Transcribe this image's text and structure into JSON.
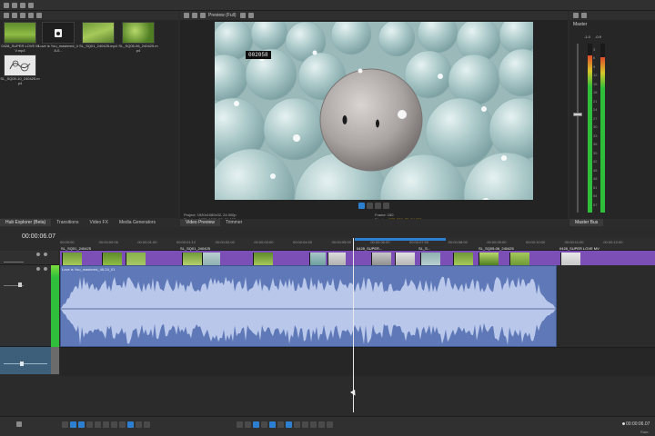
{
  "project_media": {
    "items": [
      {
        "label": "0428_SUPER LOVE MV.mp4",
        "thumb": "green-field"
      },
      {
        "label": "Love is You_mastered_48-0...",
        "thumb": "audio"
      },
      {
        "label": "SL_SQ01_240425.mp4",
        "thumb": "green-field"
      },
      {
        "label": "SL_SQ05-06_240425.mp4",
        "thumb": "green-leaves"
      },
      {
        "label": "SL_SQ09-10_240425.mp4",
        "thumb": "sketch"
      }
    ]
  },
  "left_tabs": [
    "Hub Explorer (Beta)",
    "Transitions",
    "Video FX",
    "Media Generators"
  ],
  "preview": {
    "toolbar_label": "Preview (Full)",
    "frame_badge": "002058",
    "info_project": "Project:",
    "info_project_val": "1920x1080x32, 24.000p",
    "info_preview": "Preview:",
    "info_preview_val": "1920x1080x32, 24.000p",
    "info_frame": "Frame:",
    "info_frame_val": "150",
    "info_display": "Display:",
    "info_display_val": "533x300x32, 24.000",
    "tabs": [
      "Video Preview",
      "Trimmer"
    ]
  },
  "master": {
    "title": "Master",
    "values": [
      "-1.0",
      "-0.9"
    ],
    "scale": [
      "3",
      "6",
      "9",
      "12",
      "15",
      "18",
      "21",
      "24",
      "27",
      "30",
      "33",
      "36",
      "39",
      "42",
      "45",
      "48",
      "51",
      "54",
      "57"
    ],
    "level_left": 0.93,
    "level_right": 0.92,
    "tab": "Master Bus"
  },
  "timeline": {
    "timecode": "00:00:06.07",
    "ruler": [
      "00:00:00",
      "00:00:00:06",
      "00:00:01:00",
      "00:00:01:12",
      "00:00:02:00",
      "00:00:03:00",
      "00:00:04:00",
      "00:00:05:00",
      "00:00:06:00",
      "00:00:07:00",
      "00:00:08:00",
      "00:00:09:00",
      "00:00:10:00",
      "00:00:11:00",
      "00:00:12:00"
    ],
    "video_clips": [
      "SL_SQ01_240425",
      "SL_SQ01_240425",
      "0428_SUPER...",
      "SL_S...",
      "SL_SQ05-06_240425",
      "0428_SUPER LOVE MV"
    ],
    "audio_clip": "Love is You_mastered_48-24_01",
    "end_time": "00:00:06.07",
    "rate": "Rate:"
  },
  "colors": {
    "video_track": "#7b4fb5",
    "audio_track": "#5f79b8",
    "accent": "#2d7fd1",
    "meter_green": "#2fbf3a"
  }
}
